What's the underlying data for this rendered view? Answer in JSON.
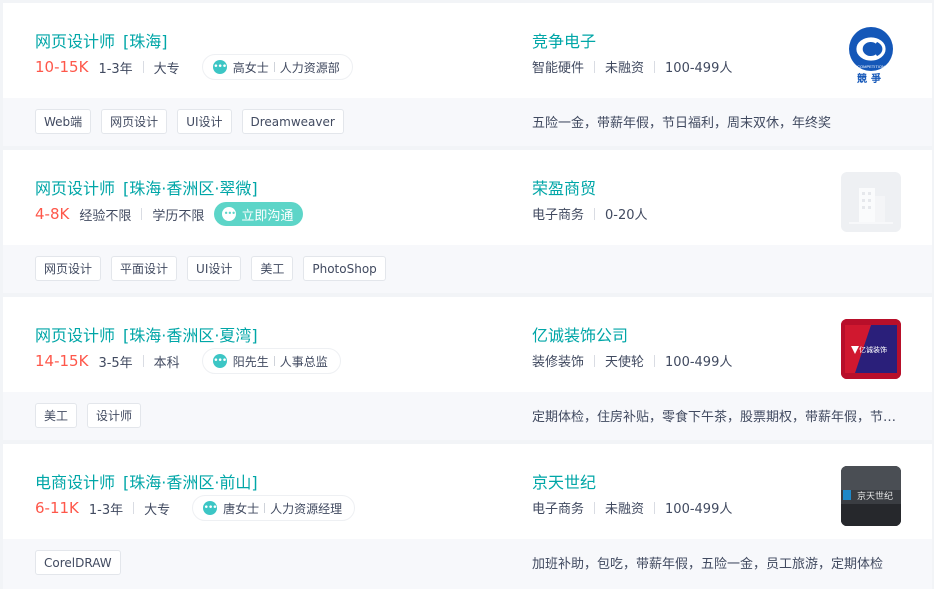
{
  "jobs": [
    {
      "title": "网页设计师",
      "area": "[珠海]",
      "salary": "10-15K",
      "experience": "1-3年",
      "degree": "大专",
      "recruiter_name": "高女士",
      "recruiter_title": "人力资源部",
      "company": "竞争电子",
      "industry": "智能硬件",
      "stage": "未融资",
      "size": "100-499人",
      "tags": [
        "Web端",
        "网页设计",
        "UI设计",
        "Dreamweaver"
      ],
      "welfare": "五险一金，带薪年假，节日福利，周末双休，年终奖",
      "logo_text": "競爭",
      "logo_ring_text": "COMPETITION"
    },
    {
      "title": "网页设计师",
      "area": "[珠海·香洲区·翠微]",
      "salary": "4-8K",
      "experience": "经验不限",
      "degree": "学历不限",
      "chat_button": "立即沟通",
      "company": "荣盈商贸",
      "industry": "电子商务",
      "size": "0-20人",
      "tags": [
        "网页设计",
        "平面设计",
        "UI设计",
        "美工",
        "PhotoShop"
      ]
    },
    {
      "title": "网页设计师",
      "area": "[珠海·香洲区·夏湾]",
      "salary": "14-15K",
      "experience": "3-5年",
      "degree": "本科",
      "recruiter_name": "阳先生",
      "recruiter_title": "人事总监",
      "company": "亿诚装饰公司",
      "industry": "装修装饰",
      "stage": "天使轮",
      "size": "100-499人",
      "tags": [
        "美工",
        "设计师"
      ],
      "welfare": "定期体检，住房补贴，零食下午茶，股票期权，带薪年假，节日福利",
      "logo_text": "亿诚装饰"
    },
    {
      "title": "电商设计师",
      "area": "[珠海·香洲区·前山]",
      "salary": "6-11K",
      "experience": "1-3年",
      "degree": "大专",
      "recruiter_name": "唐女士",
      "recruiter_title": "人力资源经理",
      "company": "京天世纪",
      "industry": "电子商务",
      "stage": "未融资",
      "size": "100-499人",
      "tags": [
        "CorelDRAW"
      ],
      "welfare": "加班补助，包吃，带薪年假，五险一金，员工旅游，定期体检",
      "logo_text": "京天世纪"
    }
  ],
  "colors": {
    "accent": "#00a6a7",
    "salary": "#fe574a",
    "chat_button": "#5dd5c8",
    "logo_blue": "#1457b8",
    "logo_dark_red": "#c0122a"
  }
}
